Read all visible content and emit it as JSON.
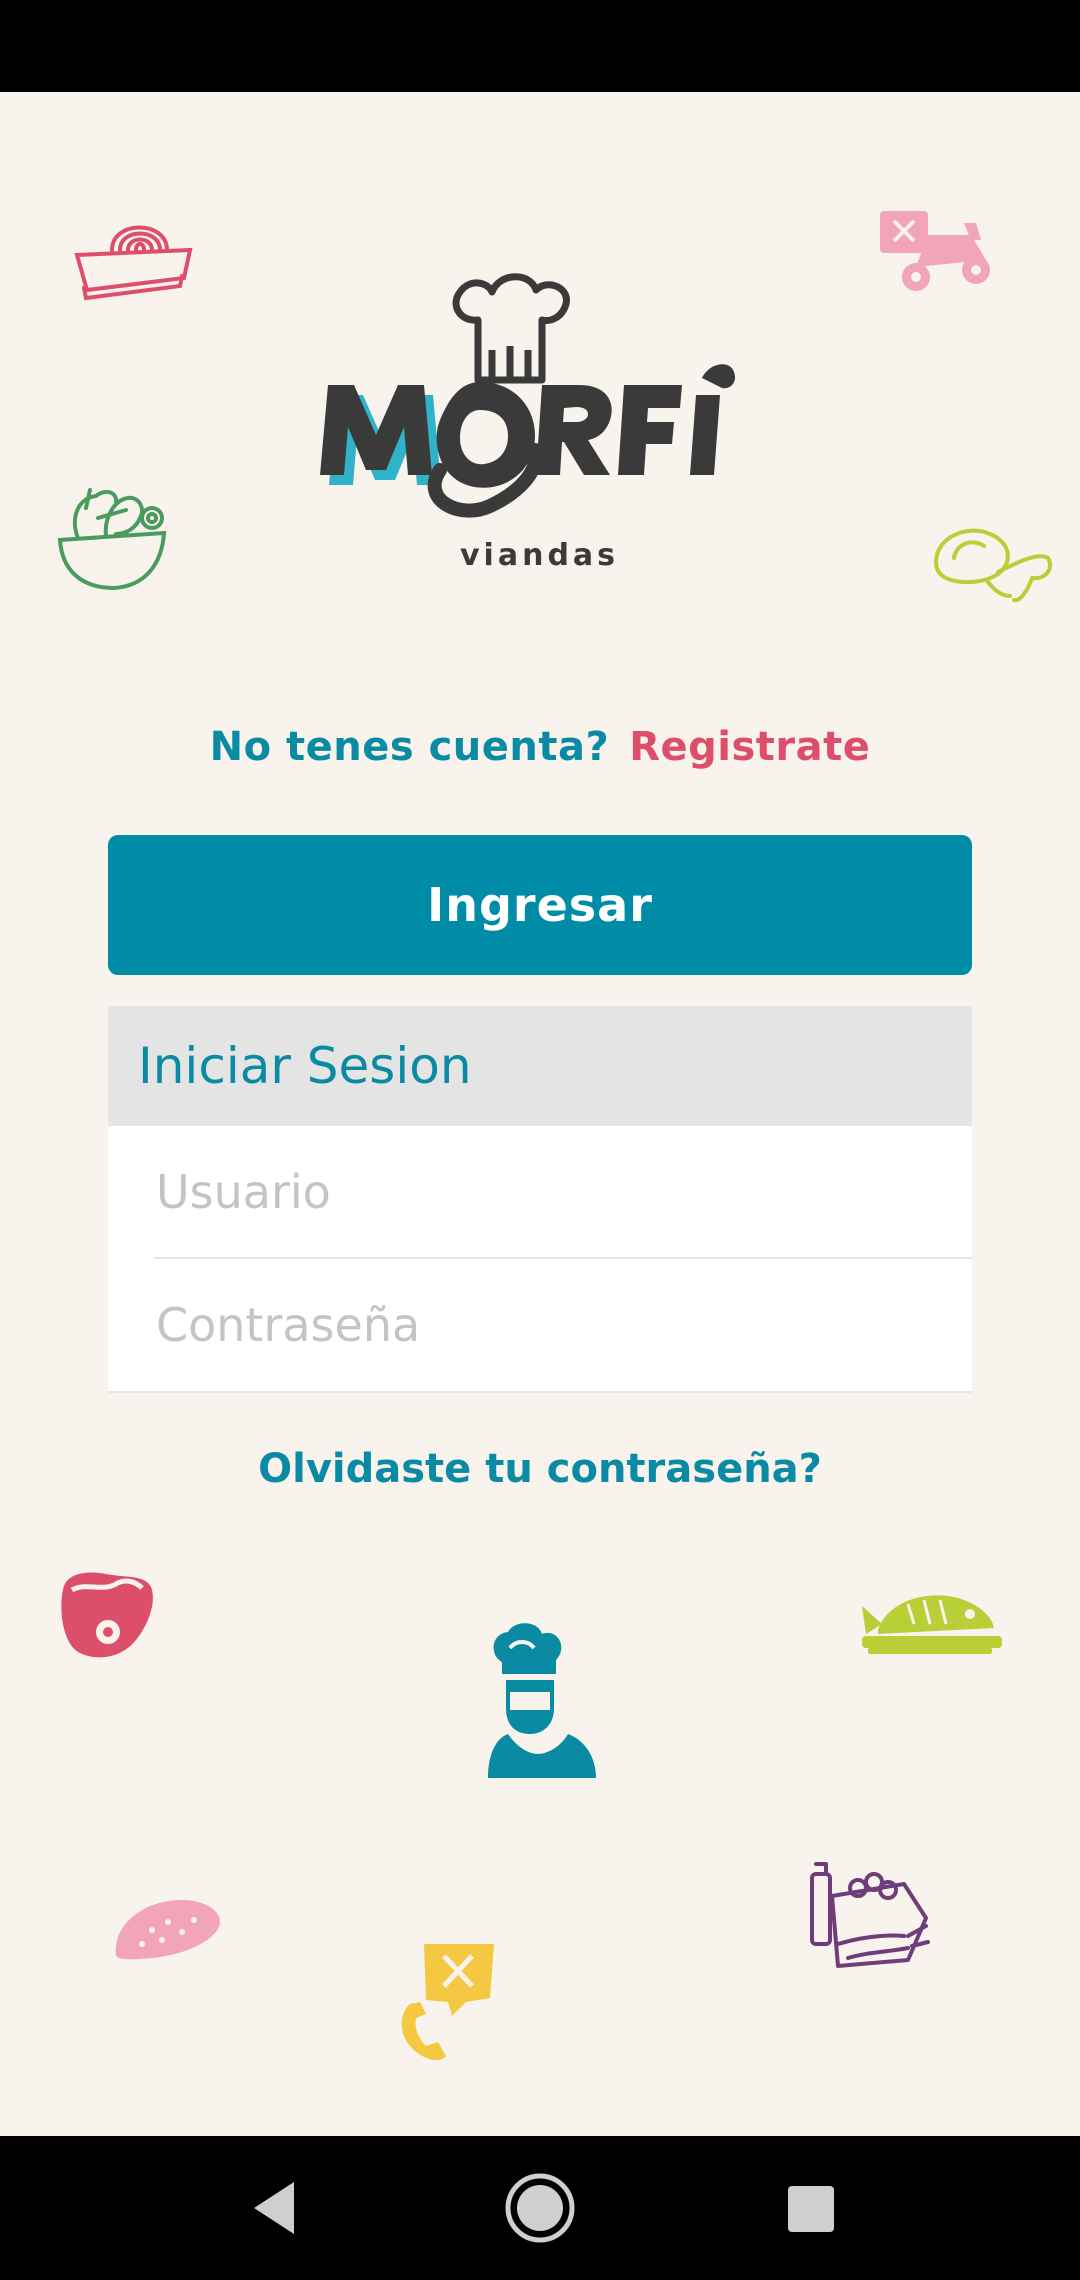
{
  "brand": {
    "name": "MORFI",
    "tagline": "viandas"
  },
  "signup": {
    "question": "No tenes cuenta?",
    "link": "Registrate"
  },
  "login": {
    "button_label": "Ingresar",
    "panel_title": "Iniciar Sesion",
    "username_placeholder": "Usuario",
    "username_value": "",
    "password_placeholder": "Contraseña",
    "password_value": "",
    "forgot_link": "Olvidaste tu contraseña?"
  },
  "colors": {
    "background": "#f8f3ec",
    "primary_teal": "#008ca6",
    "accent_pink": "#dd4e6a",
    "logo_dark": "#3a3a3a",
    "decor_green": "#4a9b5d",
    "decor_lime": "#b8cf38",
    "decor_purple": "#6e3d7a",
    "decor_yellow": "#f5c842",
    "decor_light_pink": "#f2a5b8"
  },
  "icons": {
    "decorations": [
      "noodle-bowl-icon",
      "delivery-scooter-icon",
      "salad-bowl-icon",
      "chicken-leg-icon",
      "steak-icon",
      "fish-platter-icon",
      "chef-icon",
      "taco-icon",
      "phone-order-icon",
      "grocery-bag-icon"
    ],
    "nav": [
      "back-icon",
      "home-icon",
      "recents-icon"
    ]
  }
}
